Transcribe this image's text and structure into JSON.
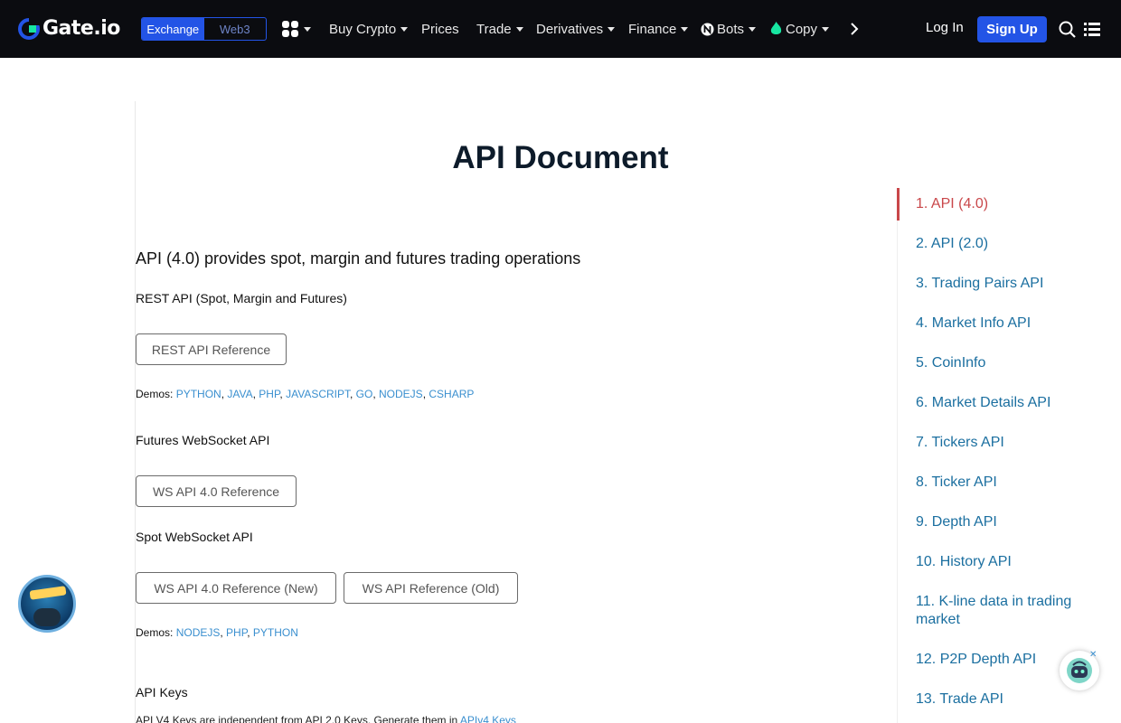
{
  "header": {
    "logo_text": "Gate.io",
    "switch": {
      "exchange": "Exchange",
      "web3": "Web3"
    },
    "menu": [
      {
        "label": "Buy Crypto",
        "caret": true
      },
      {
        "label": "Prices",
        "caret": false
      },
      {
        "label": "Trade",
        "caret": true
      },
      {
        "label": "Derivatives",
        "caret": true
      },
      {
        "label": "Finance",
        "caret": true
      },
      {
        "label": "Bots",
        "caret": true
      },
      {
        "label": "Copy",
        "caret": true
      }
    ],
    "login": "Log In",
    "signup": "Sign Up",
    "icons": {
      "apps": "apps-grid-icon",
      "bots": "bots-icon",
      "copy": "flame-icon",
      "more": "chevron-right-icon",
      "search": "search-icon",
      "menu": "list-menu-icon"
    }
  },
  "main": {
    "title": "API Document",
    "subtitle": "API (4.0) provides spot, margin and futures trading operations",
    "rest": {
      "heading": "REST API (Spot, Margin and Futures)",
      "button": "REST API Reference",
      "demos_label": "Demos:",
      "demos": [
        "PYTHON",
        "JAVA",
        "PHP",
        "JAVASCRIPT",
        "GO",
        "NODEJS",
        "CSHARP"
      ]
    },
    "futures_ws": {
      "heading": "Futures WebSocket API",
      "button": "WS API 4.0 Reference"
    },
    "spot_ws": {
      "heading": "Spot WebSocket API",
      "button_new": "WS API 4.0 Reference (New)",
      "button_old": "WS API Reference (Old)",
      "demos_label": "Demos:",
      "demos": [
        "NODEJS",
        "PHP",
        "PYTHON"
      ]
    },
    "keys": {
      "heading": "API Keys",
      "text": "API V4 Keys are independent from API 2.0 Keys. Generate them in ",
      "link": "APIv4 Keys"
    }
  },
  "toc": {
    "items": [
      "1. API (4.0)",
      "2. API (2.0)",
      "3. Trading Pairs API",
      "4. Market Info API",
      "5. CoinInfo",
      "6. Market Details API",
      "7. Tickers API",
      "8. Ticker API",
      "9. Depth API",
      "10. History API",
      "11. K-line data in trading market",
      "12. P2P Depth API",
      "13. Trade API"
    ],
    "active_index": 0
  },
  "colors": {
    "nav_bg": "#0b0c10",
    "brand_blue": "#2354e6",
    "link": "#3a8fcf",
    "toc_link": "#1b6fa0",
    "toc_active": "#c9474a"
  }
}
